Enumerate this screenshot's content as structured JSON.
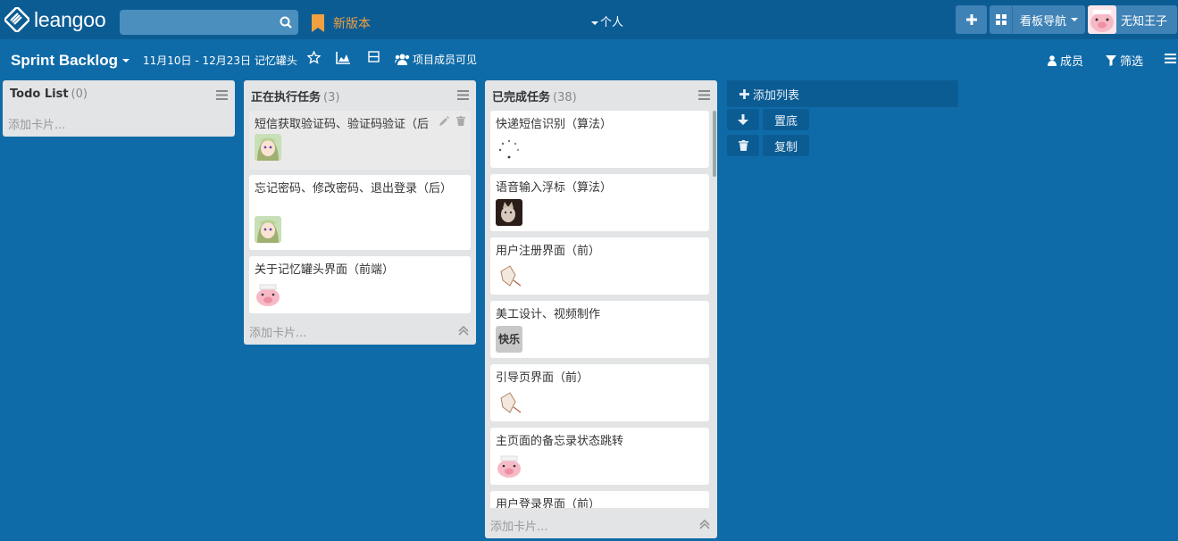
{
  "app": {
    "logo_text": "leangoo"
  },
  "topbar": {
    "search_placeholder": "",
    "new_version": "新版本",
    "personal": "个人",
    "board_nav": "看板导航",
    "user_name": "无知王子"
  },
  "board": {
    "title": "Sprint Backlog",
    "dates": "11月10日 - 12月23日",
    "project": "记忆罐头",
    "visibility": "项目成员可见",
    "members": "成员",
    "filter": "筛选"
  },
  "lists": [
    {
      "title": "Todo List",
      "count": "(0)",
      "add_card": "添加卡片..."
    },
    {
      "title": "正在执行任务",
      "count": "(3)",
      "add_card": "添加卡片...",
      "cards": [
        {
          "text": "短信获取验证码、验证码验证（后",
          "avatar": "anime-girl"
        },
        {
          "text": "忘记密码、修改密码、退出登录（后）",
          "avatar": "anime-girl"
        },
        {
          "text": "关于记忆罐头界面（前端）",
          "avatar": "pink-pig"
        }
      ]
    },
    {
      "title": "已完成任务",
      "count": "(38)",
      "add_card": "添加卡片...",
      "cards": [
        {
          "text": "快递短信识别（算法）",
          "avatar": "loading-spinner"
        },
        {
          "text": "语音输入浮标（算法）",
          "avatar": "cat-photo"
        },
        {
          "text": "用户注册界面（前）",
          "avatar": "sketch-figure"
        },
        {
          "text": "美工设计、视频制作",
          "avatar": "text-avatar",
          "avatar_text": "快乐"
        },
        {
          "text": "引导页界面（前）",
          "avatar": "sketch-figure"
        },
        {
          "text": "主页面的备忘录状态跳转",
          "avatar": "pink-pig"
        },
        {
          "text": "用户登录界面（前）",
          "avatar": "none"
        }
      ]
    }
  ],
  "side": {
    "add_list": "添加列表",
    "to_bottom": "置底",
    "copy": "复制"
  },
  "colors": {
    "background": "#0f6ba8",
    "topbar": "#0c5c94",
    "list": "#e2e4e6",
    "accent_orange": "#f0a040"
  }
}
